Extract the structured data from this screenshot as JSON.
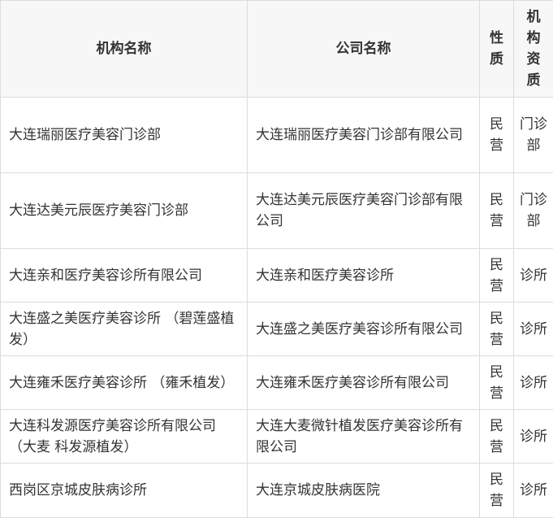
{
  "headers": [
    "机构名称",
    "公司名称",
    "性质",
    "机构资质"
  ],
  "rows": [
    {
      "name": "大连瑞丽医疗美容门诊部",
      "company": "大连瑞丽医疗美容门诊部有限公司",
      "nature": "民营",
      "qual": "门诊部"
    },
    {
      "name": "大连达美元辰医疗美容门诊部",
      "company": "大连达美元辰医疗美容门诊部有限公司",
      "nature": "民营",
      "qual": "门诊部"
    },
    {
      "name": "大连亲和医疗美容诊所有限公司",
      "company": "大连亲和医疗美容诊所",
      "nature": "民营",
      "qual": "诊所"
    },
    {
      "name": "大连盛之美医疗美容诊所 （碧莲盛植发）",
      "company": "大连盛之美医疗美容诊所有限公司",
      "nature": "民营",
      "qual": "诊所"
    },
    {
      "name": "大连雍禾医疗美容诊所 （雍禾植发）",
      "company": "大连雍禾医疗美容诊所有限公司",
      "nature": "民营",
      "qual": "诊所"
    },
    {
      "name": "大连科发源医疗美容诊所有限公司 （大麦 科发源植发）",
      "company": "大连大麦微针植发医疗美容诊所有限公司",
      "nature": "民营",
      "qual": "诊所"
    },
    {
      "name": "西岗区京城皮肤病诊所",
      "company": "大连京城皮肤病医院",
      "nature": "民营",
      "qual": "诊所"
    }
  ]
}
